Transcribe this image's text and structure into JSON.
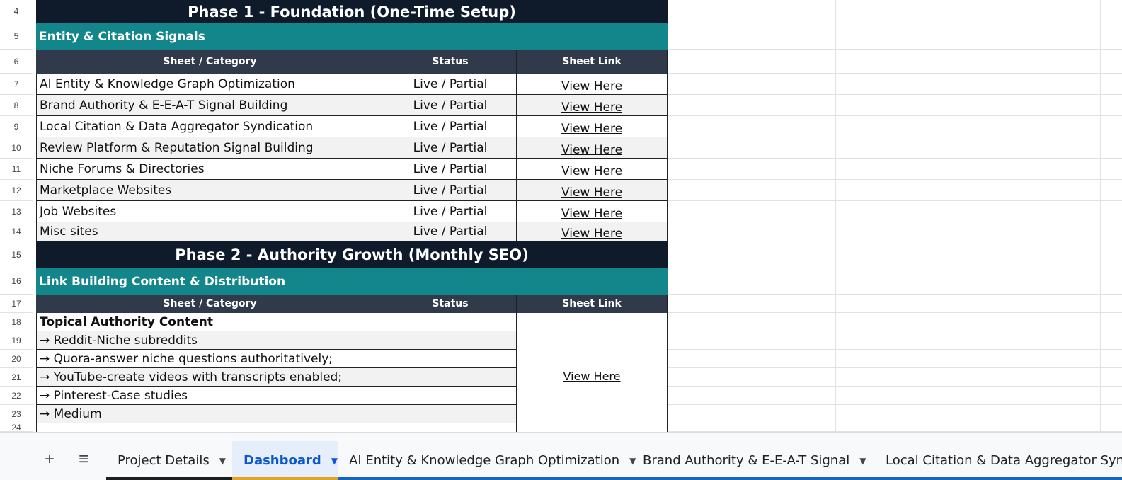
{
  "row_numbers": [
    "4",
    "5",
    "6",
    "7",
    "8",
    "9",
    "10",
    "11",
    "12",
    "13",
    "14",
    "15",
    "16",
    "17",
    "18",
    "19",
    "20",
    "21",
    "22",
    "23",
    "24"
  ],
  "phase1": {
    "title": "Phase 1 - Foundation (One-Time Setup)",
    "section": "Entity & Citation Signals",
    "headers": [
      "Sheet / Category",
      "Status",
      "Sheet Link"
    ],
    "rows": [
      {
        "category": "AI Entity & Knowledge Graph Optimization",
        "status": "Live / Partial",
        "link": "View Here"
      },
      {
        "category": "Brand Authority & E-E-A-T Signal Building",
        "status": "Live / Partial",
        "link": "View Here"
      },
      {
        "category": "Local Citation & Data Aggregator Syndication",
        "status": "Live / Partial",
        "link": "View Here"
      },
      {
        "category": "Review Platform & Reputation Signal Building",
        "status": "Live / Partial",
        "link": "View Here"
      },
      {
        "category": "Niche Forums & Directories",
        "status": "Live / Partial",
        "link": "View Here"
      },
      {
        "category": "Marketplace Websites",
        "status": "Live / Partial",
        "link": "View Here"
      },
      {
        "category": "Job Websites",
        "status": "Live / Partial",
        "link": "View Here"
      },
      {
        "category": "Misc sites",
        "status": "Live / Partial",
        "link": "View Here"
      }
    ]
  },
  "phase2": {
    "title": "Phase 2 - Authority Growth (Monthly SEO)",
    "section": "Link Building Content & Distribution",
    "headers": [
      "Sheet / Category",
      "Status",
      "Sheet Link"
    ],
    "rows": [
      {
        "category": "Topical Authority Content",
        "status": ""
      },
      {
        "category": "→ Reddit-Niche subreddits",
        "status": ""
      },
      {
        "category": "→ Quora-answer niche questions authoritatively;",
        "status": ""
      },
      {
        "category": "→ YouTube-create videos with transcripts enabled;",
        "status": ""
      },
      {
        "category": "→ Pinterest-Case studies",
        "status": ""
      },
      {
        "category": "→ Medium",
        "status": ""
      }
    ],
    "link": "View Here"
  },
  "tabs": {
    "add_label": "+",
    "menu_label": "≡",
    "items": [
      {
        "label": "Project Details",
        "color": "#1f1f1f",
        "active": false
      },
      {
        "label": "Dashboard",
        "color": "#e0a42b",
        "active": true
      },
      {
        "label": "AI Entity & Knowledge Graph Optimization",
        "color": "#1565c0",
        "active": false
      },
      {
        "label": "Brand Authority & E-E-A-T Signal",
        "color": "#1565c0",
        "active": false
      },
      {
        "label": "Local Citation & Data Aggregator Syn",
        "color": "#1565c0",
        "active": false
      }
    ]
  },
  "colors": {
    "phase_bg": "#0f1b2b",
    "section_bg": "#12868a",
    "header_bg": "#313a4a",
    "active_tab_text": "#0b57d0"
  }
}
